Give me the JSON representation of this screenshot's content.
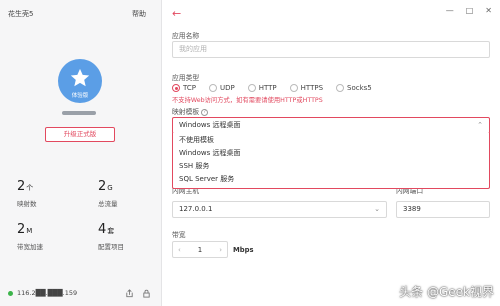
{
  "left": {
    "app_name": "花生壳5",
    "help": "帮助",
    "tier": "体验版",
    "upgrade": "升级正式版",
    "stats": [
      {
        "num": "2",
        "unit": "个",
        "label": "映射数"
      },
      {
        "num": "2",
        "unit": "G",
        "label": "总流量"
      },
      {
        "num": "2",
        "unit": "M",
        "label": "带宽加速"
      },
      {
        "num": "4",
        "unit": "套",
        "label": "配置项目"
      }
    ],
    "ip": "116.2██.███.159"
  },
  "form": {
    "app_name_label": "应用名称",
    "app_name_placeholder": "我的应用",
    "app_type_label": "应用类型",
    "types": [
      "TCP",
      "UDP",
      "HTTP",
      "HTTPS",
      "Socks5"
    ],
    "selected_type": "TCP",
    "warning": "不支持Web访问方式，如有需要请使用HTTP或HTTPS",
    "template_label": "映射模板",
    "template_value": "Windows 远程桌面",
    "template_options": [
      "不使用模板",
      "Windows 远程桌面",
      "SSH 服务",
      "SQL Server 服务"
    ],
    "host_label": "内网主机",
    "host_value": "127.0.0.1",
    "port_label": "内网端口",
    "port_value": "3389",
    "bandwidth_label": "带宽",
    "bandwidth_value": "1",
    "bandwidth_unit": "Mbps"
  },
  "watermark": "头条 @Geek视界",
  "colors": {
    "accent": "#e2495f",
    "avatar": "#5b9ee6",
    "online": "#3cb44b"
  }
}
